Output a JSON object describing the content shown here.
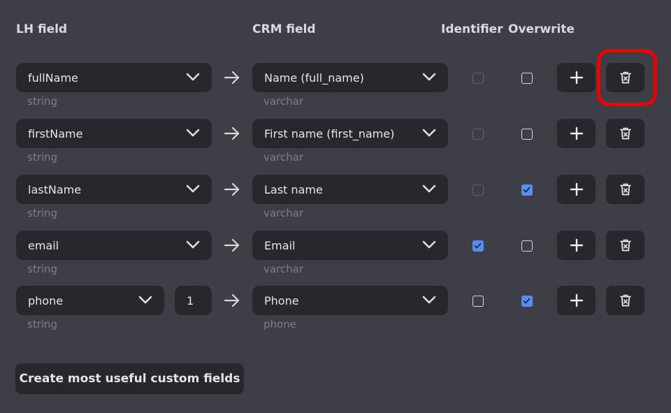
{
  "headers": {
    "lh_field": "LH field",
    "crm_field": "CRM field",
    "identifier": "Identifier",
    "overwrite": "Overwrite"
  },
  "colors": {
    "background": "#3e3f46",
    "control": "#27282d",
    "checkbox_checked": "#5b8def",
    "highlight": "#f00000"
  },
  "rows": [
    {
      "lh_field": "fullName",
      "lh_type": "string",
      "crm_field": "Name (full_name)",
      "crm_type": "varchar",
      "identifier": false,
      "identifier_enabled": false,
      "overwrite": false
    },
    {
      "lh_field": "firstName",
      "lh_type": "string",
      "crm_field": "First name (first_name)",
      "crm_type": "varchar",
      "identifier": false,
      "identifier_enabled": false,
      "overwrite": false
    },
    {
      "lh_field": "lastName",
      "lh_type": "string",
      "crm_field": "Last name",
      "crm_type": "varchar",
      "identifier": false,
      "identifier_enabled": false,
      "overwrite": true
    },
    {
      "lh_field": "email",
      "lh_type": "string",
      "crm_field": "Email",
      "crm_type": "varchar",
      "identifier": true,
      "identifier_enabled": true,
      "overwrite": false
    },
    {
      "lh_field": "phone",
      "lh_type": "string",
      "index": "1",
      "crm_field": "Phone",
      "crm_type": "phone",
      "identifier": false,
      "identifier_enabled": true,
      "overwrite": true
    }
  ],
  "icons": {
    "arrow": "arrow-right-icon",
    "chevron": "chevron-down-icon",
    "add": "plus-icon",
    "delete": "trash-icon"
  },
  "create_button_label": "Create most useful custom fields"
}
